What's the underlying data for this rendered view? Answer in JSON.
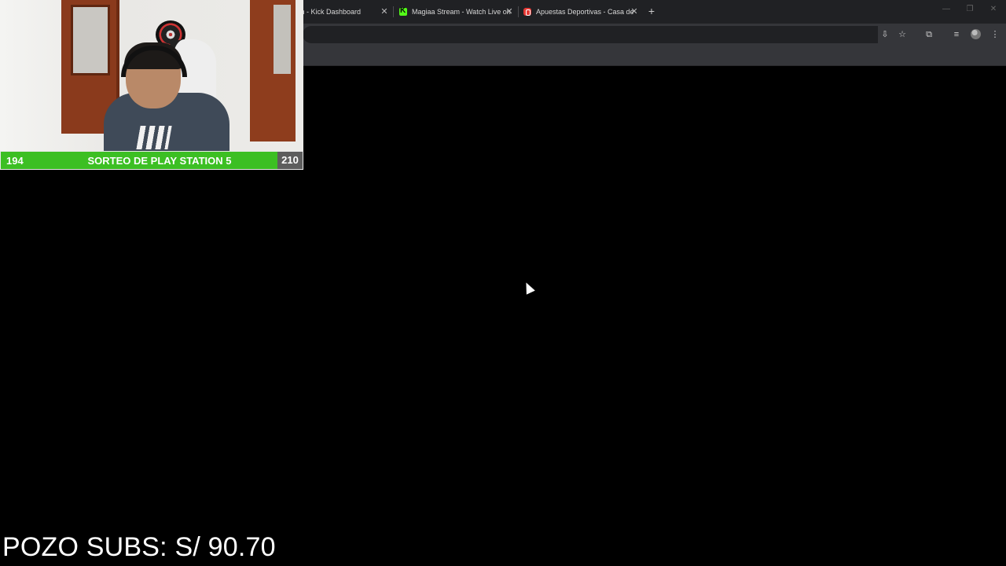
{
  "browser": {
    "tabs": [
      {
        "title": "m - Kick Dashboard",
        "favicon": "none"
      },
      {
        "title": "Magiaa Stream - Watch Live on",
        "favicon": "kick-logo-icon"
      },
      {
        "title": "Apuestas Deportivas - Casa de",
        "favicon": "betting-site-icon"
      }
    ],
    "close_glyph": "✕",
    "new_tab_glyph": "+",
    "window_controls": {
      "minimize": "—",
      "restore": "❐",
      "close": "✕"
    },
    "toolbar_icons": [
      "install-icon",
      "bookmark-star-icon",
      "extensions-icon",
      "media-controls-icon",
      "profile-avatar-icon",
      "menu-kebab-icon"
    ],
    "toolbar_glyphs": {
      "install": "⇩",
      "star": "☆",
      "extensions": "⧉",
      "media": "≡",
      "menu": "⋮"
    }
  },
  "overlay": {
    "banner_left": "194",
    "banner_title": "SORTEO DE PLAY STATION 5",
    "banner_right": "210",
    "pozo_text": "POZO SUBS: S/ 90.70"
  },
  "colors": {
    "banner_green": "#3cbf23",
    "banner_gray": "#5d5d5d",
    "kick_green": "#53fc18",
    "chrome_dark": "#202124",
    "chrome_toolbar": "#35363a"
  }
}
